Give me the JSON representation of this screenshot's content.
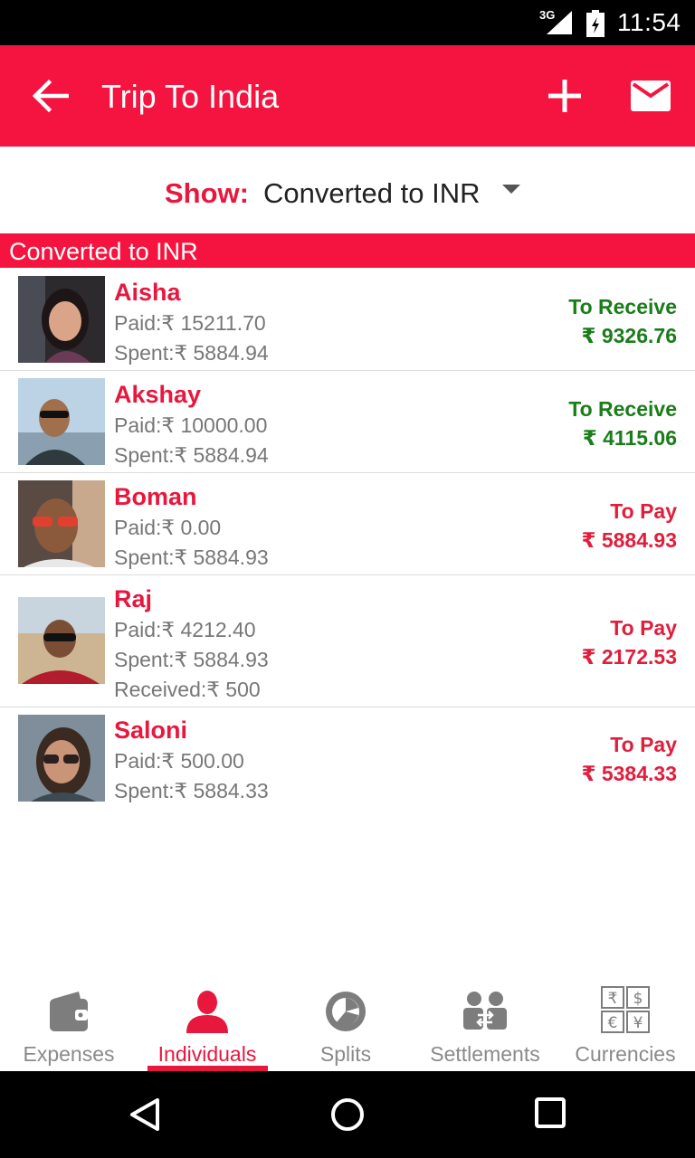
{
  "status_bar": {
    "network": "3G",
    "time": "11:54"
  },
  "app_bar": {
    "title": "Trip To India"
  },
  "show": {
    "label": "Show:",
    "value": "Converted to INR"
  },
  "section": {
    "title": "Converted to INR"
  },
  "people": [
    {
      "name": "Aisha",
      "lines": [
        "Paid:₹  15211.70",
        "Spent:₹  5884.94"
      ],
      "status": "To Receive",
      "amount": "₹  9326.76",
      "kind": "receive"
    },
    {
      "name": "Akshay",
      "lines": [
        "Paid:₹  10000.00",
        "Spent:₹  5884.94"
      ],
      "status": "To Receive",
      "amount": "₹  4115.06",
      "kind": "receive"
    },
    {
      "name": "Boman",
      "lines": [
        "Paid:₹  0.00",
        "Spent:₹  5884.93"
      ],
      "status": "To Pay",
      "amount": "₹  5884.93",
      "kind": "pay"
    },
    {
      "name": "Raj",
      "lines": [
        "Paid:₹  4212.40",
        "Spent:₹  5884.93",
        "Received:₹  500"
      ],
      "status": "To Pay",
      "amount": "₹  2172.53",
      "kind": "pay"
    },
    {
      "name": "Saloni",
      "lines": [
        "Paid:₹  500.00",
        "Spent:₹  5884.33"
      ],
      "status": "To Pay",
      "amount": "₹  5384.33",
      "kind": "pay"
    }
  ],
  "bottom_nav": [
    {
      "label": "Expenses",
      "icon": "wallet-icon",
      "active": false
    },
    {
      "label": "Individuals",
      "icon": "person-icon",
      "active": true
    },
    {
      "label": "Splits",
      "icon": "pie-icon",
      "active": false
    },
    {
      "label": "Settlements",
      "icon": "people-exchange-icon",
      "active": false
    },
    {
      "label": "Currencies",
      "icon": "currency-icon",
      "active": false
    }
  ],
  "currency_symbols": [
    "₹",
    "$",
    "€",
    "¥"
  ],
  "colors": {
    "primary": "#f5143f",
    "receive": "#1a7d1a",
    "pay": "#e01e3c",
    "inactive": "#8a8a8a"
  }
}
